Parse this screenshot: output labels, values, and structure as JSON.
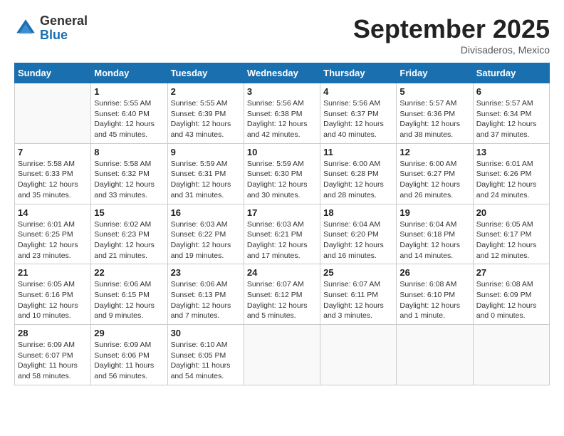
{
  "logo": {
    "general": "General",
    "blue": "Blue"
  },
  "header": {
    "month": "September 2025",
    "location": "Divisaderos, Mexico"
  },
  "weekdays": [
    "Sunday",
    "Monday",
    "Tuesday",
    "Wednesday",
    "Thursday",
    "Friday",
    "Saturday"
  ],
  "weeks": [
    [
      {
        "day": "",
        "info": ""
      },
      {
        "day": "1",
        "info": "Sunrise: 5:55 AM\nSunset: 6:40 PM\nDaylight: 12 hours\nand 45 minutes."
      },
      {
        "day": "2",
        "info": "Sunrise: 5:55 AM\nSunset: 6:39 PM\nDaylight: 12 hours\nand 43 minutes."
      },
      {
        "day": "3",
        "info": "Sunrise: 5:56 AM\nSunset: 6:38 PM\nDaylight: 12 hours\nand 42 minutes."
      },
      {
        "day": "4",
        "info": "Sunrise: 5:56 AM\nSunset: 6:37 PM\nDaylight: 12 hours\nand 40 minutes."
      },
      {
        "day": "5",
        "info": "Sunrise: 5:57 AM\nSunset: 6:36 PM\nDaylight: 12 hours\nand 38 minutes."
      },
      {
        "day": "6",
        "info": "Sunrise: 5:57 AM\nSunset: 6:34 PM\nDaylight: 12 hours\nand 37 minutes."
      }
    ],
    [
      {
        "day": "7",
        "info": "Sunrise: 5:58 AM\nSunset: 6:33 PM\nDaylight: 12 hours\nand 35 minutes."
      },
      {
        "day": "8",
        "info": "Sunrise: 5:58 AM\nSunset: 6:32 PM\nDaylight: 12 hours\nand 33 minutes."
      },
      {
        "day": "9",
        "info": "Sunrise: 5:59 AM\nSunset: 6:31 PM\nDaylight: 12 hours\nand 31 minutes."
      },
      {
        "day": "10",
        "info": "Sunrise: 5:59 AM\nSunset: 6:30 PM\nDaylight: 12 hours\nand 30 minutes."
      },
      {
        "day": "11",
        "info": "Sunrise: 6:00 AM\nSunset: 6:28 PM\nDaylight: 12 hours\nand 28 minutes."
      },
      {
        "day": "12",
        "info": "Sunrise: 6:00 AM\nSunset: 6:27 PM\nDaylight: 12 hours\nand 26 minutes."
      },
      {
        "day": "13",
        "info": "Sunrise: 6:01 AM\nSunset: 6:26 PM\nDaylight: 12 hours\nand 24 minutes."
      }
    ],
    [
      {
        "day": "14",
        "info": "Sunrise: 6:01 AM\nSunset: 6:25 PM\nDaylight: 12 hours\nand 23 minutes."
      },
      {
        "day": "15",
        "info": "Sunrise: 6:02 AM\nSunset: 6:23 PM\nDaylight: 12 hours\nand 21 minutes."
      },
      {
        "day": "16",
        "info": "Sunrise: 6:03 AM\nSunset: 6:22 PM\nDaylight: 12 hours\nand 19 minutes."
      },
      {
        "day": "17",
        "info": "Sunrise: 6:03 AM\nSunset: 6:21 PM\nDaylight: 12 hours\nand 17 minutes."
      },
      {
        "day": "18",
        "info": "Sunrise: 6:04 AM\nSunset: 6:20 PM\nDaylight: 12 hours\nand 16 minutes."
      },
      {
        "day": "19",
        "info": "Sunrise: 6:04 AM\nSunset: 6:18 PM\nDaylight: 12 hours\nand 14 minutes."
      },
      {
        "day": "20",
        "info": "Sunrise: 6:05 AM\nSunset: 6:17 PM\nDaylight: 12 hours\nand 12 minutes."
      }
    ],
    [
      {
        "day": "21",
        "info": "Sunrise: 6:05 AM\nSunset: 6:16 PM\nDaylight: 12 hours\nand 10 minutes."
      },
      {
        "day": "22",
        "info": "Sunrise: 6:06 AM\nSunset: 6:15 PM\nDaylight: 12 hours\nand 9 minutes."
      },
      {
        "day": "23",
        "info": "Sunrise: 6:06 AM\nSunset: 6:13 PM\nDaylight: 12 hours\nand 7 minutes."
      },
      {
        "day": "24",
        "info": "Sunrise: 6:07 AM\nSunset: 6:12 PM\nDaylight: 12 hours\nand 5 minutes."
      },
      {
        "day": "25",
        "info": "Sunrise: 6:07 AM\nSunset: 6:11 PM\nDaylight: 12 hours\nand 3 minutes."
      },
      {
        "day": "26",
        "info": "Sunrise: 6:08 AM\nSunset: 6:10 PM\nDaylight: 12 hours\nand 1 minute."
      },
      {
        "day": "27",
        "info": "Sunrise: 6:08 AM\nSunset: 6:09 PM\nDaylight: 12 hours\nand 0 minutes."
      }
    ],
    [
      {
        "day": "28",
        "info": "Sunrise: 6:09 AM\nSunset: 6:07 PM\nDaylight: 11 hours\nand 58 minutes."
      },
      {
        "day": "29",
        "info": "Sunrise: 6:09 AM\nSunset: 6:06 PM\nDaylight: 11 hours\nand 56 minutes."
      },
      {
        "day": "30",
        "info": "Sunrise: 6:10 AM\nSunset: 6:05 PM\nDaylight: 11 hours\nand 54 minutes."
      },
      {
        "day": "",
        "info": ""
      },
      {
        "day": "",
        "info": ""
      },
      {
        "day": "",
        "info": ""
      },
      {
        "day": "",
        "info": ""
      }
    ]
  ]
}
